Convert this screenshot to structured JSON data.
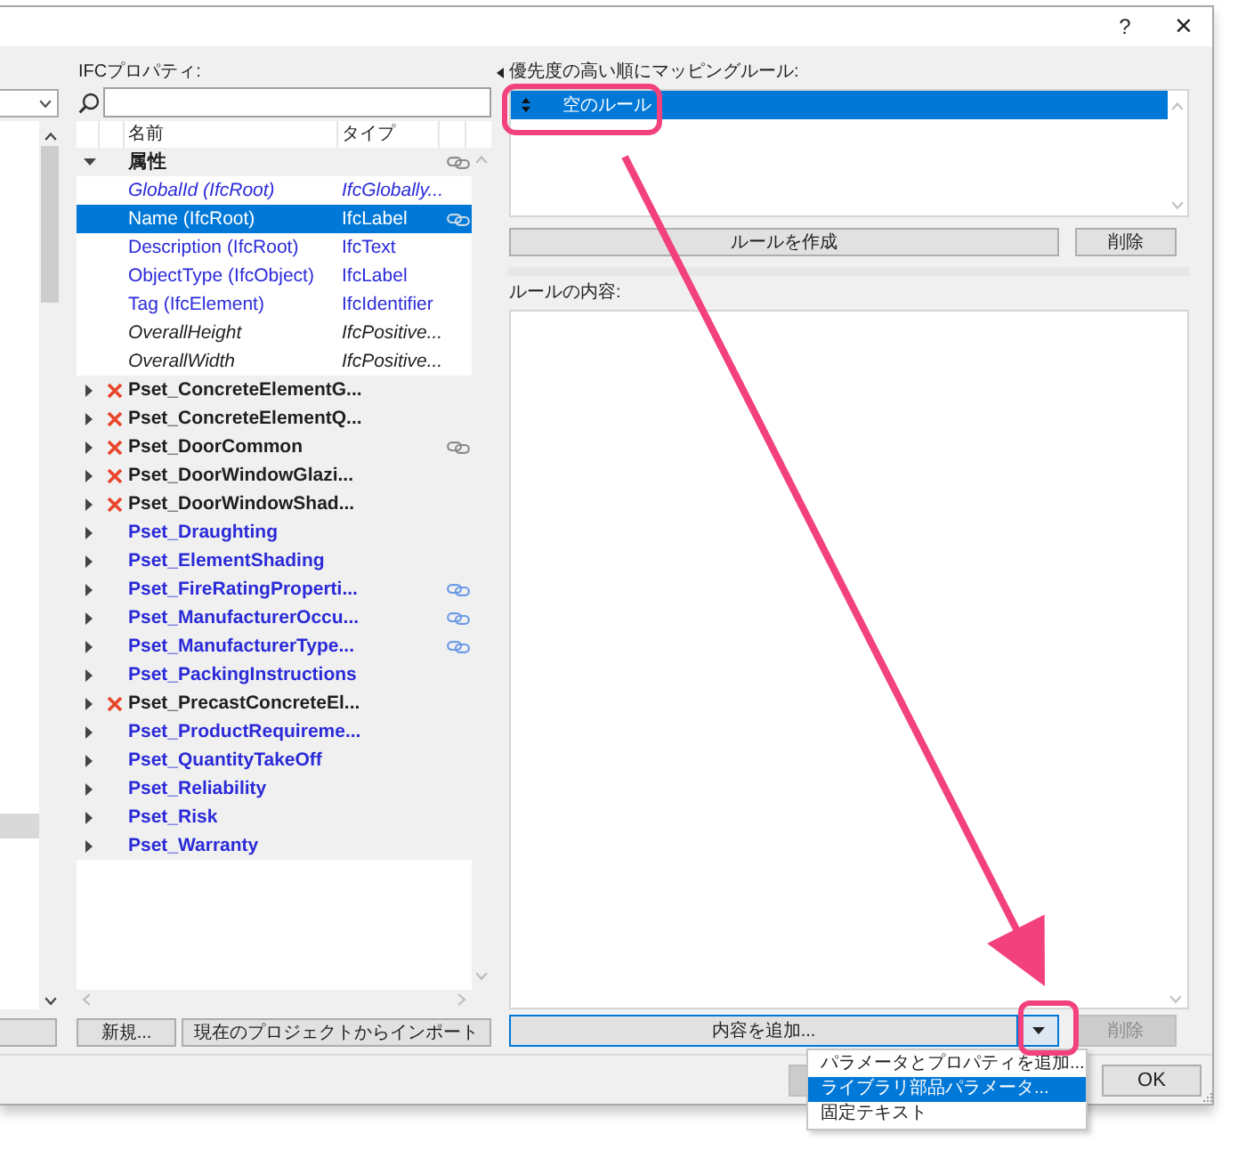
{
  "window": {
    "help": "?",
    "close": "×"
  },
  "ifc_properties": {
    "label": "IFCプロパティ:",
    "columns": [
      "名前",
      "タイプ"
    ],
    "tree": [
      {
        "kind": "category",
        "name": "属性",
        "expanded": true,
        "linked": true,
        "selected": false,
        "children": [
          {
            "name": "GlobalId (IfcRoot)",
            "type": "IfcGlobally...",
            "available": true,
            "read_only": true,
            "linked": false,
            "selected": false
          },
          {
            "name": "Name (IfcRoot)",
            "type": "IfcLabel",
            "available": true,
            "read_only": false,
            "linked": true,
            "selected": true
          },
          {
            "name": "Description (IfcRoot)",
            "type": "IfcText",
            "available": true,
            "read_only": false,
            "linked": false,
            "selected": false
          },
          {
            "name": "ObjectType (IfcObject)",
            "type": "IfcLabel",
            "available": true,
            "read_only": false,
            "linked": false,
            "selected": false
          },
          {
            "name": "Tag (IfcElement)",
            "type": "IfcIdentifier",
            "available": true,
            "read_only": false,
            "linked": false,
            "selected": false
          },
          {
            "name": "OverallHeight",
            "type": "IfcPositive...",
            "available": false,
            "read_only": true,
            "linked": false,
            "selected": false
          },
          {
            "name": "OverallWidth",
            "type": "IfcPositive...",
            "available": false,
            "read_only": true,
            "linked": false,
            "selected": false
          }
        ]
      },
      {
        "kind": "pset",
        "name": "Pset_ConcreteElementG...",
        "expanded": false,
        "available": false,
        "linked": false,
        "selected": false
      },
      {
        "kind": "pset",
        "name": "Pset_ConcreteElementQ...",
        "expanded": false,
        "available": false,
        "linked": false,
        "selected": false
      },
      {
        "kind": "pset",
        "name": "Pset_DoorCommon",
        "expanded": false,
        "available": false,
        "linked": true,
        "selected": false
      },
      {
        "kind": "pset",
        "name": "Pset_DoorWindowGlazi...",
        "expanded": false,
        "available": false,
        "linked": false,
        "selected": false
      },
      {
        "kind": "pset",
        "name": "Pset_DoorWindowShad...",
        "expanded": false,
        "available": false,
        "linked": false,
        "selected": false
      },
      {
        "kind": "pset",
        "name": "Pset_Draughting",
        "expanded": false,
        "available": true,
        "linked": false,
        "selected": false
      },
      {
        "kind": "pset",
        "name": "Pset_ElementShading",
        "expanded": false,
        "available": true,
        "linked": false,
        "selected": false
      },
      {
        "kind": "pset",
        "name": "Pset_FireRatingProperti...",
        "expanded": false,
        "available": true,
        "linked": true,
        "selected": false
      },
      {
        "kind": "pset",
        "name": "Pset_ManufacturerOccu...",
        "expanded": false,
        "available": true,
        "linked": true,
        "selected": false
      },
      {
        "kind": "pset",
        "name": "Pset_ManufacturerType...",
        "expanded": false,
        "available": true,
        "linked": true,
        "selected": false
      },
      {
        "kind": "pset",
        "name": "Pset_PackingInstructions",
        "expanded": false,
        "available": true,
        "linked": false,
        "selected": false
      },
      {
        "kind": "pset",
        "name": "Pset_PrecastConcreteEl...",
        "expanded": false,
        "available": false,
        "linked": false,
        "selected": false
      },
      {
        "kind": "pset",
        "name": "Pset_ProductRequireme...",
        "expanded": false,
        "available": true,
        "linked": false,
        "selected": false
      },
      {
        "kind": "pset",
        "name": "Pset_QuantityTakeOff",
        "expanded": false,
        "available": true,
        "linked": false,
        "selected": false
      },
      {
        "kind": "pset",
        "name": "Pset_Reliability",
        "expanded": false,
        "available": true,
        "linked": false,
        "selected": false
      },
      {
        "kind": "pset",
        "name": "Pset_Risk",
        "expanded": false,
        "available": true,
        "linked": false,
        "selected": false
      },
      {
        "kind": "pset",
        "name": "Pset_Warranty",
        "expanded": false,
        "available": true,
        "linked": false,
        "selected": false
      }
    ],
    "buttons": [
      "新規...",
      "現在のプロジェクトからインポート"
    ]
  },
  "mapping_rules": {
    "label": "優先度の高い順にマッピングルール:",
    "rules": [
      {
        "name": "空のルール",
        "selected": true
      }
    ],
    "buttons": [
      {
        "label": "ルールを作成",
        "disabled": false
      },
      {
        "label": "削除",
        "disabled": false
      }
    ]
  },
  "rule_content": {
    "label": "ルールの内容:",
    "add_button": "内容を追加...",
    "delete_button": {
      "label": "削除",
      "disabled": true
    },
    "menu": [
      {
        "label": "パラメータとプロパティを追加...",
        "selected": false
      },
      {
        "label": "ライブラリ部品パラメータ...",
        "selected": true
      },
      {
        "label": "固定テキスト",
        "selected": false
      }
    ]
  },
  "footer": {
    "ok_button": "OK"
  }
}
